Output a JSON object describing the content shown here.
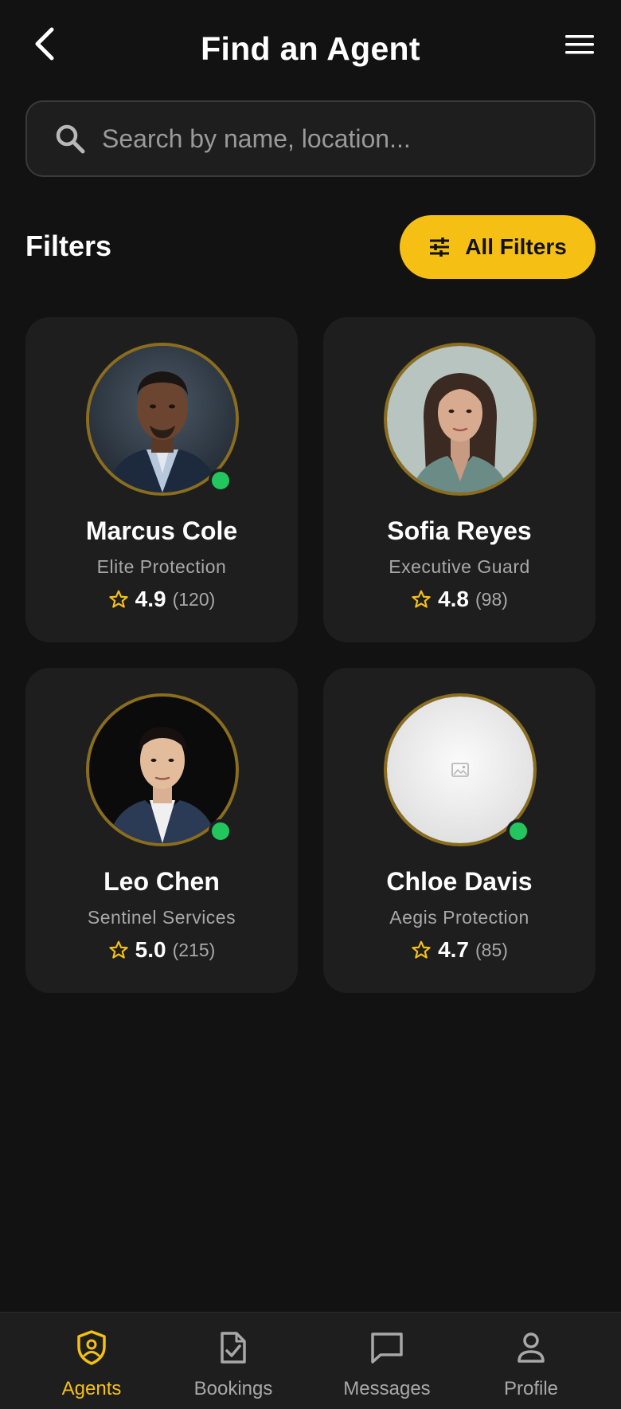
{
  "header": {
    "title": "Find an Agent",
    "back_icon": "chevron-left-icon",
    "menu_icon": "hamburger-menu-icon"
  },
  "search": {
    "placeholder": "Search by name, location...",
    "value": "",
    "icon": "search-icon"
  },
  "filters": {
    "label": "Filters",
    "button_label": "All Filters",
    "button_icon": "sliders-icon"
  },
  "colors": {
    "accent": "#f5c013",
    "online": "#22c55e",
    "background": "#121212",
    "card": "#1e1e1e",
    "avatar_ring": "#8a6d1f"
  },
  "agents": [
    {
      "name": "Marcus Cole",
      "company": "Elite Protection",
      "rating": "4.9",
      "reviews": "(120)",
      "online": true,
      "avatar": "portrait-man-dark-suit"
    },
    {
      "name": "Sofia Reyes",
      "company": "Executive Guard",
      "rating": "4.8",
      "reviews": "(98)",
      "online": false,
      "avatar": "portrait-woman-long-hair"
    },
    {
      "name": "Leo Chen",
      "company": "Sentinel Services",
      "rating": "5.0",
      "reviews": "(215)",
      "online": true,
      "avatar": "portrait-man-navy-suit"
    },
    {
      "name": "Chloe Davis",
      "company": "Aegis Protection",
      "rating": "4.7",
      "reviews": "(85)",
      "online": true,
      "avatar": "image-placeholder-icon"
    }
  ],
  "nav": {
    "items": [
      {
        "label": "Agents",
        "icon": "shield-user-icon",
        "active": true
      },
      {
        "label": "Bookings",
        "icon": "document-check-icon",
        "active": false
      },
      {
        "label": "Messages",
        "icon": "chat-bubble-icon",
        "active": false
      },
      {
        "label": "Profile",
        "icon": "person-icon",
        "active": false
      }
    ]
  }
}
